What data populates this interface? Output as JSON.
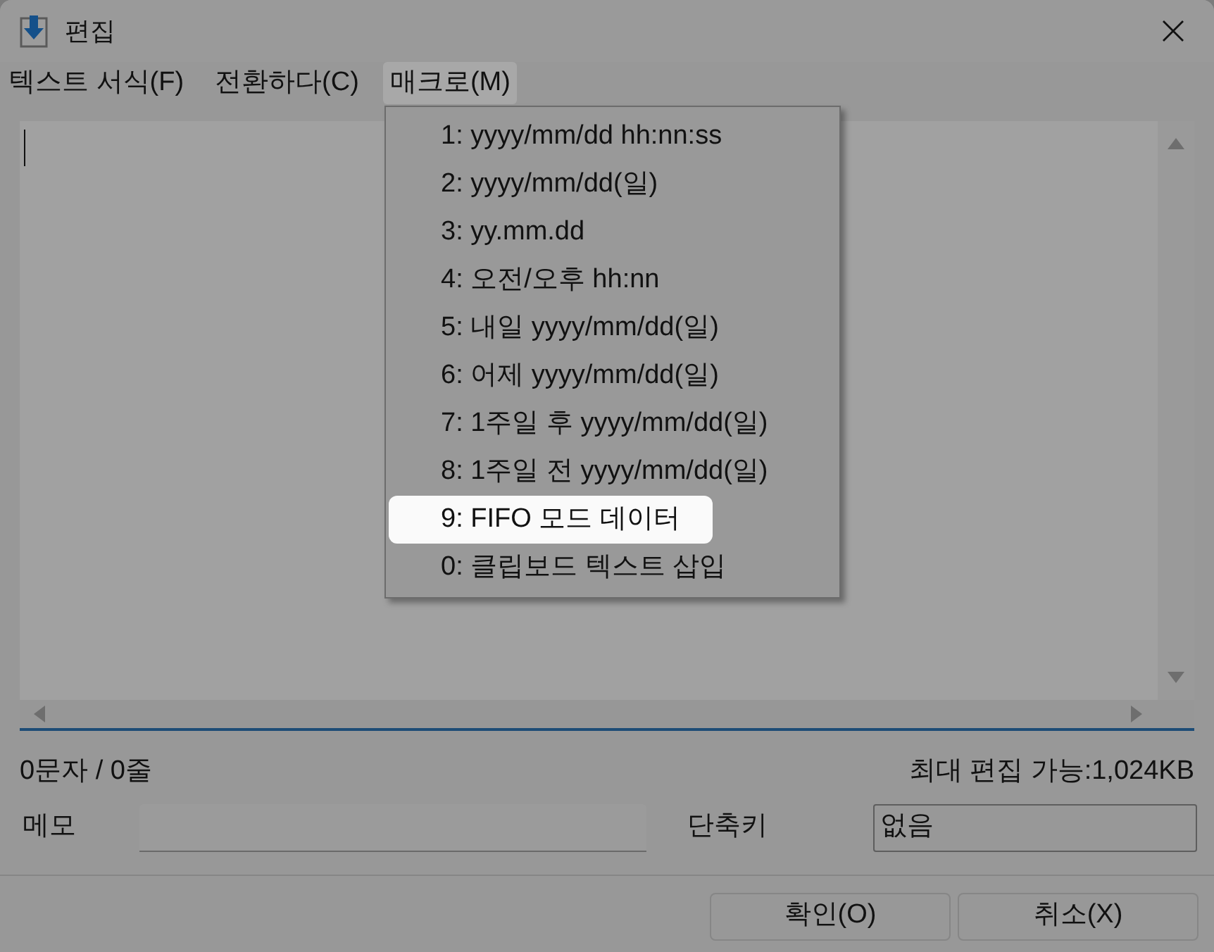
{
  "window": {
    "title": "편집"
  },
  "menu_bar": [
    {
      "label": "텍스트 서식(F)",
      "selected": false
    },
    {
      "label": "전환하다(C)",
      "selected": false
    },
    {
      "label": "매크로(M)",
      "selected": true
    }
  ],
  "macro_menu": {
    "items": [
      {
        "label": "1: yyyy/mm/dd hh:nn:ss",
        "selected": false
      },
      {
        "label": "2: yyyy/mm/dd(일)",
        "selected": false
      },
      {
        "label": "3: yy.mm.dd",
        "selected": false
      },
      {
        "label": "4: 오전/오후 hh:nn",
        "selected": false
      },
      {
        "label": "5: 내일 yyyy/mm/dd(일)",
        "selected": false
      },
      {
        "label": "6: 어제 yyyy/mm/dd(일)",
        "selected": false
      },
      {
        "label": "7: 1주일 후 yyyy/mm/dd(일)",
        "selected": false
      },
      {
        "label": "8: 1주일 전 yyyy/mm/dd(일)",
        "selected": false
      },
      {
        "label": "9: FIFO 모드 데이터",
        "selected": true
      },
      {
        "label": "0: 클립보드 텍스트 삽입",
        "selected": false
      }
    ]
  },
  "status": {
    "counts": "0문자 / 0줄",
    "max_size": "최대 편집 가능:1,024KB"
  },
  "memo": {
    "label": "메모"
  },
  "shortcut": {
    "label": "단축키",
    "value": "없음"
  },
  "buttons": [
    {
      "label": "확인(O)"
    },
    {
      "label": "취소(X)"
    }
  ]
}
